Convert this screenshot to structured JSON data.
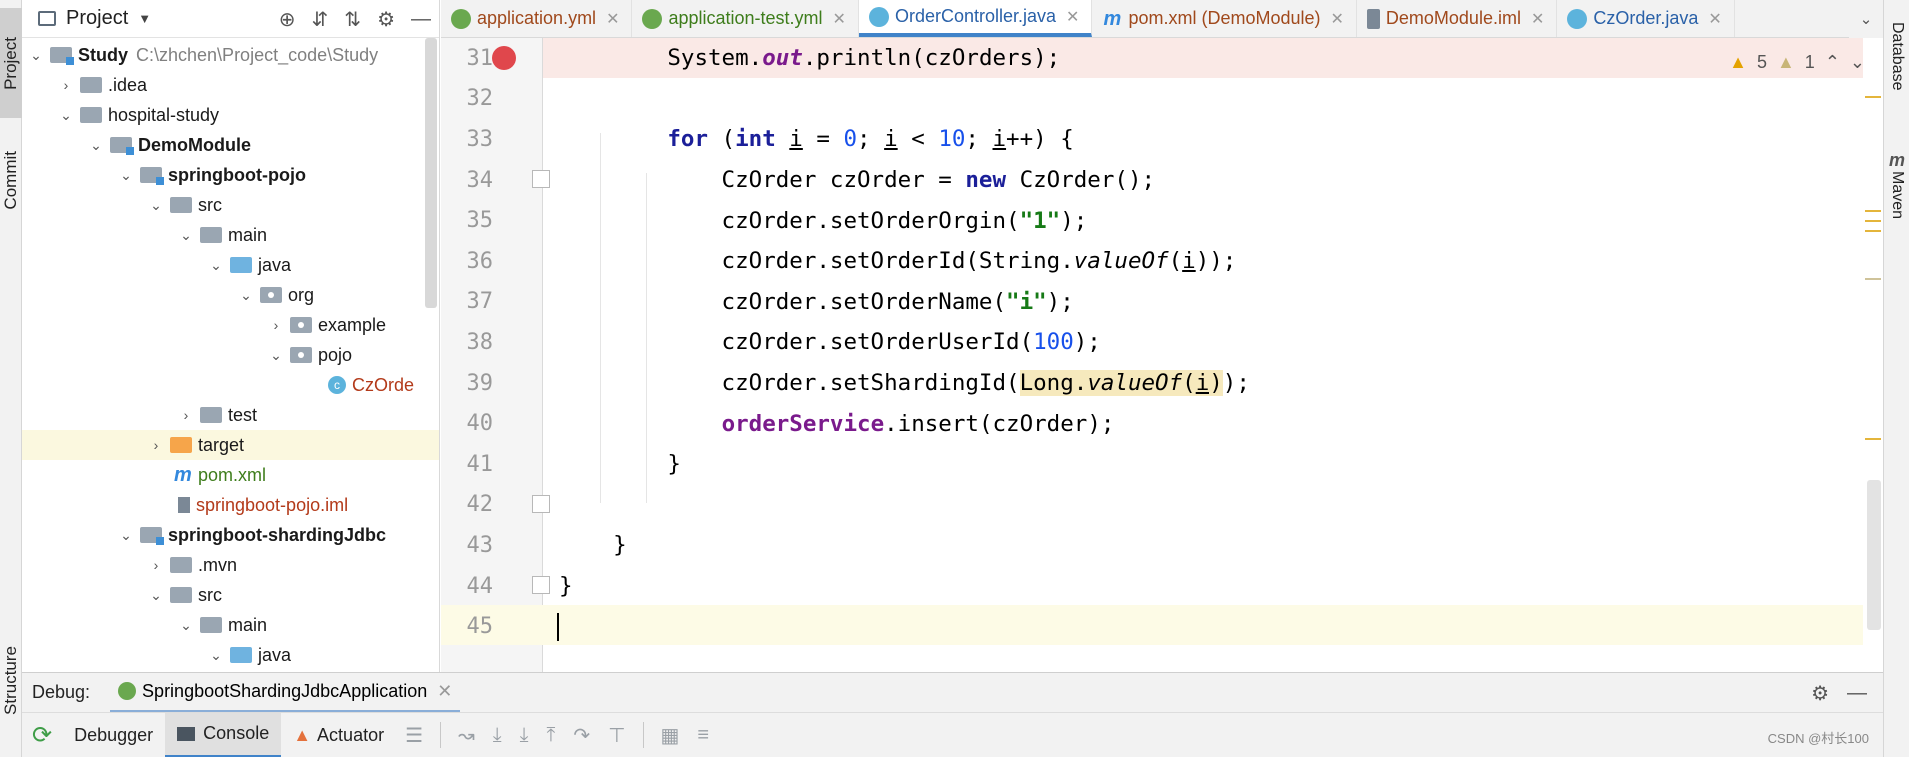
{
  "left_strip": {
    "project": "Project",
    "commit": "Commit",
    "structure": "Structure"
  },
  "right_strip": {
    "database": "Database",
    "maven": "Maven"
  },
  "project_panel": {
    "title": "Project",
    "tree": [
      {
        "label": "Study",
        "path": "C:\\zhchen\\Project_code\\Study"
      },
      {
        "label": ".idea"
      },
      {
        "label": "hospital-study"
      },
      {
        "label": "DemoModule"
      },
      {
        "label": "springboot-pojo"
      },
      {
        "label": "src"
      },
      {
        "label": "main"
      },
      {
        "label": "java"
      },
      {
        "label": "org"
      },
      {
        "label": "example"
      },
      {
        "label": "pojo"
      },
      {
        "label": "CzOrde"
      },
      {
        "label": "test"
      },
      {
        "label": "target"
      },
      {
        "label": "pom.xml"
      },
      {
        "label": "springboot-pojo.iml"
      },
      {
        "label": "springboot-shardingJdbc"
      },
      {
        "label": ".mvn"
      },
      {
        "label": "src"
      },
      {
        "label": "main"
      },
      {
        "label": "java"
      }
    ]
  },
  "tabs": [
    {
      "label": "application.yml"
    },
    {
      "label": "application-test.yml"
    },
    {
      "label": "OrderController.java"
    },
    {
      "label": "pom.xml (DemoModule)"
    },
    {
      "label": "DemoModule.iml"
    },
    {
      "label": "CzOrder.java"
    }
  ],
  "inspections": {
    "warnings": "5",
    "weak_warnings": "1"
  },
  "editor": {
    "lines": [
      {
        "n": "31",
        "tokens": [
          [
            "",
            "        System."
          ],
          [
            "fld it",
            "out"
          ],
          [
            "",
            ".println(czOrders);"
          ]
        ]
      },
      {
        "n": "32",
        "tokens": []
      },
      {
        "n": "33",
        "tokens": [
          [
            "",
            "        "
          ],
          [
            "kw",
            "for"
          ],
          [
            "",
            " ("
          ],
          [
            "kw",
            "int"
          ],
          [
            "",
            " "
          ],
          [
            "ul",
            "i"
          ],
          [
            "",
            " = "
          ],
          [
            "num",
            "0"
          ],
          [
            "",
            "; "
          ],
          [
            "ul",
            "i"
          ],
          [
            "",
            " < "
          ],
          [
            "num",
            "10"
          ],
          [
            "",
            "; "
          ],
          [
            "ul",
            "i"
          ],
          [
            "",
            "++) {"
          ]
        ]
      },
      {
        "n": "34",
        "tokens": [
          [
            "",
            "            CzOrder czOrder = "
          ],
          [
            "kw",
            "new"
          ],
          [
            "",
            " CzOrder();"
          ]
        ]
      },
      {
        "n": "35",
        "tokens": [
          [
            "",
            "            czOrder.setOrderOrgin("
          ],
          [
            "str",
            "\"1\""
          ],
          [
            "",
            ");"
          ]
        ]
      },
      {
        "n": "36",
        "tokens": [
          [
            "",
            "            czOrder.setOrderId(String."
          ],
          [
            "it",
            "valueOf"
          ],
          [
            "",
            "("
          ],
          [
            "ul",
            "i"
          ],
          [
            "",
            "));"
          ]
        ]
      },
      {
        "n": "37",
        "tokens": [
          [
            "",
            "            czOrder.setOrderName("
          ],
          [
            "str",
            "\"i\""
          ],
          [
            "",
            ");"
          ]
        ]
      },
      {
        "n": "38",
        "tokens": [
          [
            "",
            "            czOrder.setOrderUserId("
          ],
          [
            "num",
            "100"
          ],
          [
            "",
            ");"
          ]
        ]
      },
      {
        "n": "39",
        "tokens": [
          [
            "",
            "            czOrder.setShardingId("
          ],
          [
            "hlbg",
            "Long."
          ],
          [
            "hlbg it",
            "valueOf"
          ],
          [
            "hlbg",
            "("
          ],
          [
            "hlbg ul",
            "i"
          ],
          [
            "hlbg",
            ")"
          ],
          [
            "",
            ");"
          ]
        ]
      },
      {
        "n": "40",
        "tokens": [
          [
            "",
            "            "
          ],
          [
            "fld",
            "orderService"
          ],
          [
            "",
            ".insert(czOrder);"
          ]
        ]
      },
      {
        "n": "41",
        "tokens": [
          [
            "",
            "        }"
          ]
        ]
      },
      {
        "n": "42",
        "tokens": []
      },
      {
        "n": "43",
        "tokens": [
          [
            "",
            "    }"
          ]
        ]
      },
      {
        "n": "44",
        "tokens": [
          [
            "",
            "}"
          ]
        ]
      },
      {
        "n": "45",
        "tokens": []
      }
    ]
  },
  "debug": {
    "label": "Debug:",
    "config": "SpringbootShardingJdbcApplication",
    "toolbar": {
      "debugger": "Debugger",
      "console": "Console",
      "actuator": "Actuator"
    }
  },
  "watermark": "CSDN @村长100"
}
